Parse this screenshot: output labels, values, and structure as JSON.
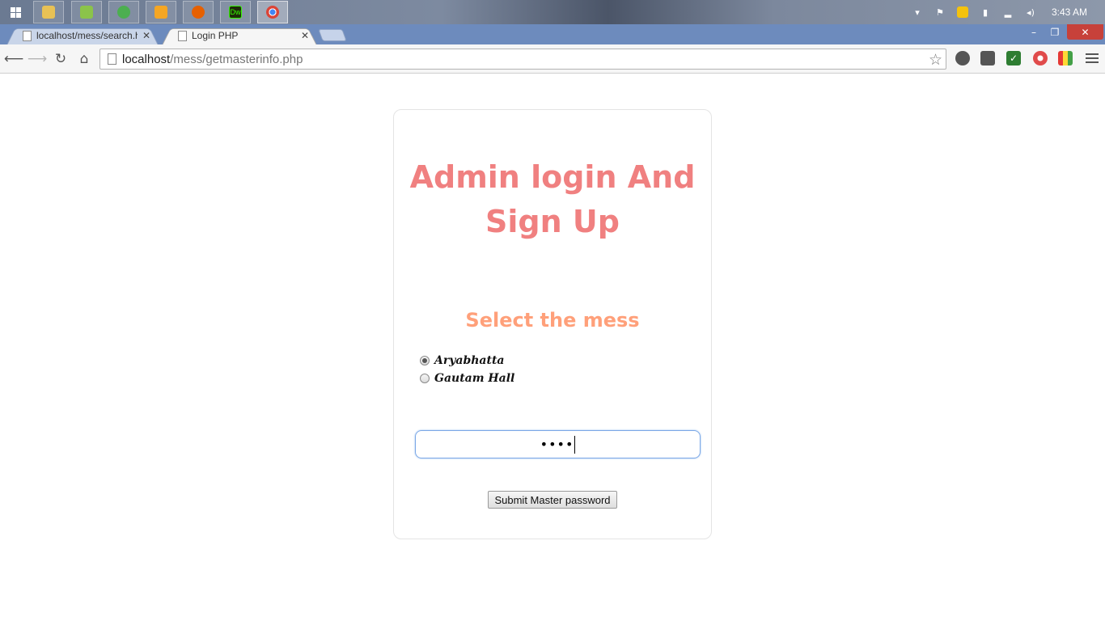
{
  "taskbar": {
    "apps": [
      {
        "icon": "file-explorer-icon",
        "color": "#e8c155"
      },
      {
        "icon": "app-icon",
        "color": "#8bc34a"
      },
      {
        "icon": "globe-icon",
        "color": "#4caf50"
      },
      {
        "icon": "media-player-icon",
        "color": "#f5a623"
      },
      {
        "icon": "firefox-icon",
        "color": "#e66000"
      },
      {
        "icon": "dreamweaver-icon",
        "color": "#35fa00",
        "text": "Dw"
      },
      {
        "icon": "chrome-icon",
        "color": "#db4437"
      }
    ],
    "clock": "3:43 AM"
  },
  "browser": {
    "tabs": [
      {
        "title": "localhost/mess/search.htm",
        "active": false
      },
      {
        "title": "Login PHP",
        "active": true
      }
    ],
    "url_host": "localhost",
    "url_path": "/mess/getmasterinfo.php"
  },
  "page": {
    "title": "Admin login And Sign Up",
    "select_heading": "Select the mess",
    "options": [
      {
        "label": "Aryabhatta",
        "checked": true
      },
      {
        "label": "Gautam Hall",
        "checked": false
      }
    ],
    "password_mask": "••••",
    "submit_label": "Submit Master password",
    "colors": {
      "title": "#f08080",
      "heading": "#ffa07a",
      "input_focus": "#7aa7e6"
    }
  }
}
